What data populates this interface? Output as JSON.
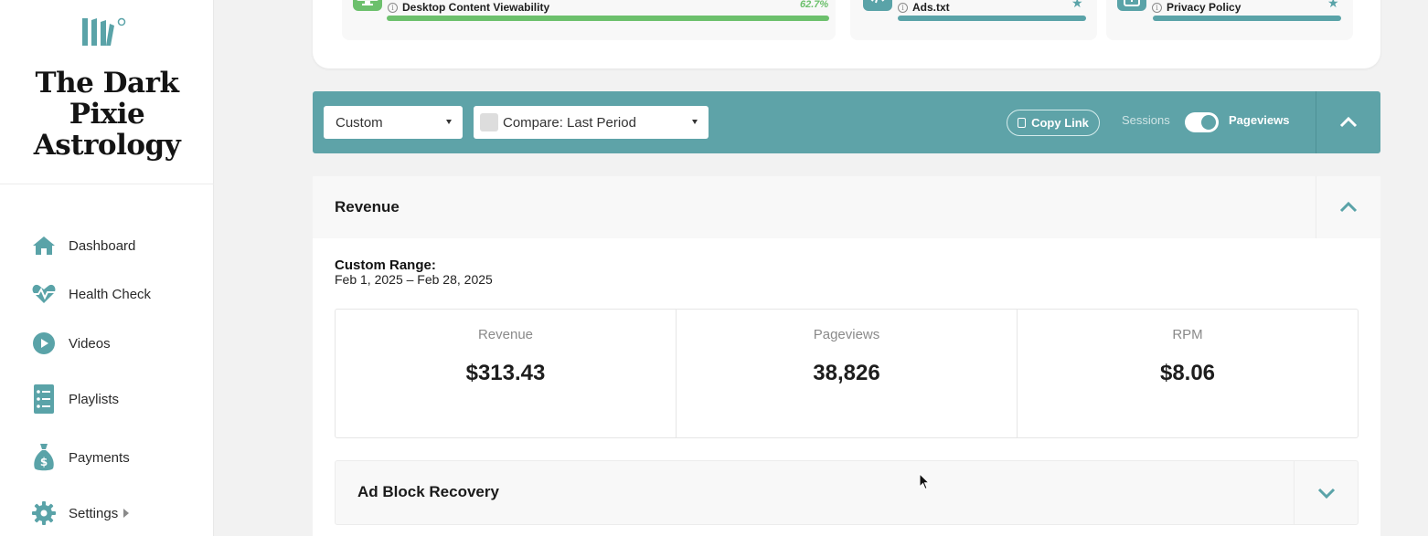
{
  "sidebar": {
    "site_title_lines": [
      "The Dark",
      "Pixie",
      "Astrology"
    ],
    "logo_icon": "brand-logo-icon",
    "items": [
      {
        "label": "Dashboard",
        "icon": "home-icon"
      },
      {
        "label": "Health Check",
        "icon": "heartbeat-icon"
      },
      {
        "label": "Videos",
        "icon": "play-circle-icon"
      },
      {
        "label": "Playlists",
        "icon": "list-icon"
      },
      {
        "label": "Payments",
        "icon": "money-bag-icon"
      },
      {
        "label": "Settings",
        "icon": "gear-icon"
      }
    ]
  },
  "health_checks": [
    {
      "label": "Desktop Content Viewability",
      "value": "62.7%",
      "progress": 0.99,
      "icon": "monitor-eye-icon",
      "bar_color": "#6cc06c",
      "icon_bg": "#6cc06c"
    },
    {
      "label": "Ads.txt",
      "icon": "code-icon",
      "progress": 1.0,
      "bar_color": "#5aa3a8",
      "icon_bg": "#5aa3a8"
    },
    {
      "label": "Privacy Policy",
      "icon": "lock-icon",
      "progress": 1.0,
      "bar_color": "#5aa3a8",
      "icon_bg": "#5aa3a8"
    }
  ],
  "toolbar": {
    "date_range_select": "Custom",
    "compare_select": "Compare: Last Period",
    "copy_link_label": "Copy Link",
    "toggle_off_label": "Sessions",
    "toggle_on_label": "Pageviews",
    "toggle_state": "Pageviews",
    "accent_color": "#5ea3a8"
  },
  "revenue": {
    "title": "Revenue",
    "range_label": "Custom Range:",
    "range_dates": "Feb 1, 2025 – Feb 28, 2025",
    "stats": [
      {
        "label": "Revenue",
        "value": "$313.43"
      },
      {
        "label": "Pageviews",
        "value": "38,826"
      },
      {
        "label": "RPM",
        "value": "$8.06"
      }
    ]
  },
  "ad_block": {
    "title": "Ad Block Recovery"
  }
}
